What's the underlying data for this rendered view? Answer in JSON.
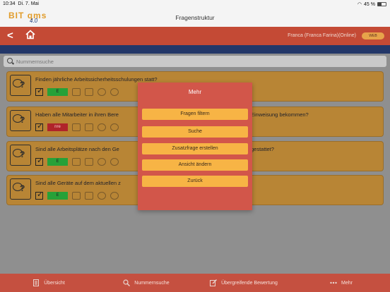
{
  "status": {
    "time": "10:34",
    "date": "Di. 7. Mai",
    "battery": "45 %"
  },
  "header": {
    "title": "Fragenstruktur",
    "logo_top": "BIT",
    "logo_qms": "qms",
    "logo_sub": "4.0"
  },
  "nav": {
    "user": "Franca (Franca Farina)(Online)",
    "brand_small": "WEB"
  },
  "search": {
    "placeholder": "Nummernsuche"
  },
  "questions": [
    {
      "text": "Finden jährliche Arbeitssicherheitsschulungen statt?",
      "rating": "E",
      "rating_color": "#27a138"
    },
    {
      "text": "Haben alle Mitarbeiter in ihren Bere",
      "text_tail": "Einweisung bekommen?",
      "rating": "nre",
      "rating_color": "#b0242a"
    },
    {
      "text": "Sind alle Arbeitsplätze nach den Ge",
      "text_tail": "gestattet?",
      "rating": "E",
      "rating_color": "#27a138"
    },
    {
      "text": "Sind alle Geräte auf dem aktuellen z",
      "rating": "E",
      "rating_color": "#27a138"
    }
  ],
  "popup": {
    "title": "Mehr",
    "buttons": [
      "Fragen filtern",
      "Suche",
      "Zusatzfrage erstellen",
      "Ansicht ändern",
      "Zurück"
    ]
  },
  "tabs": [
    {
      "label": "Übersicht",
      "icon": "document-icon"
    },
    {
      "label": "Nummernsuche",
      "icon": "search-icon"
    },
    {
      "label": "Übergreifende Bewertung",
      "icon": "edit-icon"
    },
    {
      "label": "Mehr",
      "icon": "more-icon"
    }
  ],
  "colors": {
    "accent": "#c44a35",
    "navy": "#233769",
    "card": "#b88535",
    "button": "#f7b445"
  }
}
